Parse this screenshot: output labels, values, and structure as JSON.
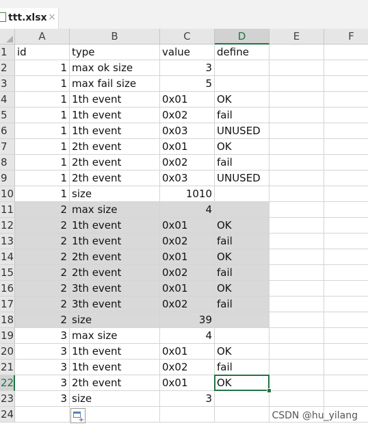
{
  "tab": {
    "label": "ttt.xlsx",
    "close_glyph": "×"
  },
  "columns": [
    "A",
    "B",
    "C",
    "D",
    "E",
    "F"
  ],
  "rows": [
    {
      "num": "1",
      "a": "id",
      "b": "type",
      "c": "value",
      "d": "define"
    },
    {
      "num": "2",
      "a": "1",
      "b": "max ok size",
      "c": "3",
      "d": ""
    },
    {
      "num": "3",
      "a": "1",
      "b": "max fail size",
      "c": "5",
      "d": ""
    },
    {
      "num": "4",
      "a": "1",
      "b": "1th event",
      "c": "0x01",
      "d": "OK"
    },
    {
      "num": "5",
      "a": "1",
      "b": "1th event",
      "c": "0x02",
      "d": "fail"
    },
    {
      "num": "6",
      "a": "1",
      "b": "1th event",
      "c": "0x03",
      "d": "UNUSED"
    },
    {
      "num": "7",
      "a": "1",
      "b": "2th event",
      "c": "0x01",
      "d": "OK"
    },
    {
      "num": "8",
      "a": "1",
      "b": "2th event",
      "c": "0x02",
      "d": "fail"
    },
    {
      "num": "9",
      "a": "1",
      "b": "2th event",
      "c": "0x03",
      "d": "UNUSED"
    },
    {
      "num": "10",
      "a": "1",
      "b": "size",
      "c": "1010",
      "d": ""
    },
    {
      "num": "11",
      "a": "2",
      "b": "max size",
      "c": "4",
      "d": ""
    },
    {
      "num": "12",
      "a": "2",
      "b": "1th event",
      "c": "0x01",
      "d": "OK"
    },
    {
      "num": "13",
      "a": "2",
      "b": "1th event",
      "c": "0x02",
      "d": "fail"
    },
    {
      "num": "14",
      "a": "2",
      "b": "2th event",
      "c": "0x01",
      "d": "OK"
    },
    {
      "num": "15",
      "a": "2",
      "b": "2th event",
      "c": "0x02",
      "d": "fail"
    },
    {
      "num": "16",
      "a": "2",
      "b": "3th event",
      "c": "0x01",
      "d": "OK"
    },
    {
      "num": "17",
      "a": "2",
      "b": "3th event",
      "c": "0x02",
      "d": "fail"
    },
    {
      "num": "18",
      "a": "2",
      "b": "size",
      "c": "39",
      "d": ""
    },
    {
      "num": "19",
      "a": "3",
      "b": "max size",
      "c": "4",
      "d": ""
    },
    {
      "num": "20",
      "a": "3",
      "b": "1th event",
      "c": "0x01",
      "d": "OK"
    },
    {
      "num": "21",
      "a": "3",
      "b": "1th event",
      "c": "0x02",
      "d": "fail"
    },
    {
      "num": "22",
      "a": "3",
      "b": "2th event",
      "c": "0x01",
      "d": "OK"
    },
    {
      "num": "23",
      "a": "3",
      "b": "size",
      "c": "3",
      "d": ""
    },
    {
      "num": "24",
      "a": "",
      "b": "",
      "c": "",
      "d": ""
    }
  ],
  "selection": {
    "cell": "D22",
    "column": "D",
    "row": "22"
  },
  "shaded_rows": [
    "11",
    "12",
    "13",
    "14",
    "15",
    "16",
    "17",
    "18"
  ],
  "colors": {
    "selection": "#217346",
    "shade": "#d9d9d9",
    "header": "#e6e6e6"
  },
  "icons": {
    "tab": "excel-file-icon",
    "paste_options": "quick-analysis-icon"
  },
  "watermark": "CSDN @hu_yilang"
}
